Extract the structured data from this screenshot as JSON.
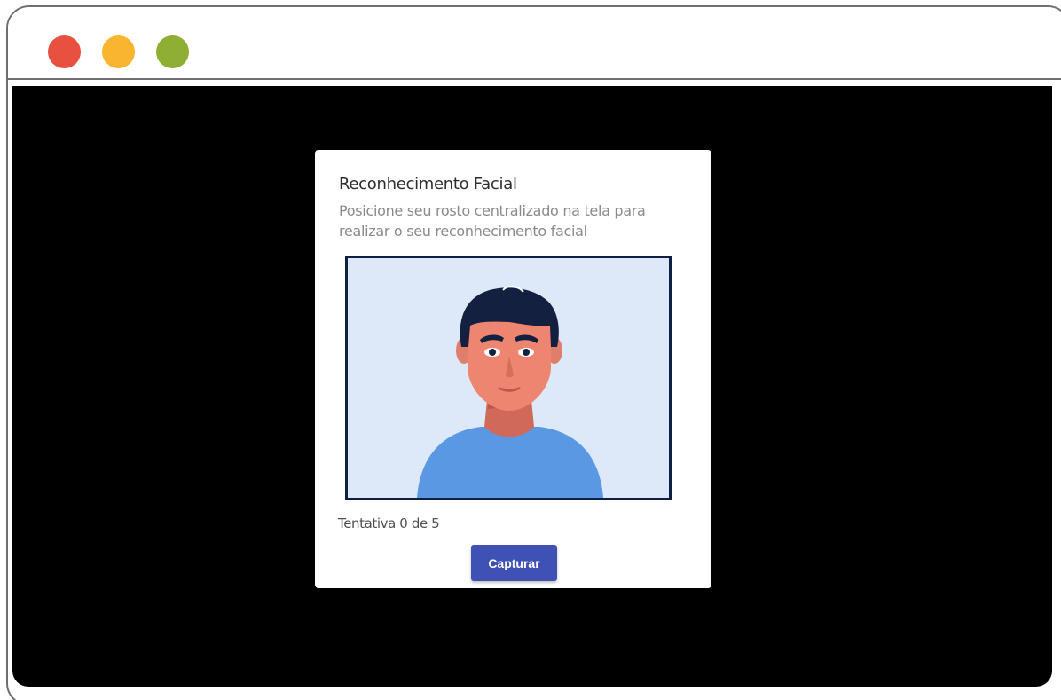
{
  "window": {
    "controls": [
      {
        "name": "close",
        "color": "#e8503f"
      },
      {
        "name": "minimize",
        "color": "#f9b530"
      },
      {
        "name": "maximize",
        "color": "#8fae34"
      }
    ]
  },
  "modal": {
    "title": "Reconhecimento Facial",
    "subtitle": "Posicione seu rosto centralizado na tela para realizar o seu reconhecimento facial",
    "camera_preview": "face-illustration",
    "attempts_text": "Tentativa 0 de 5",
    "attempts_current": 0,
    "attempts_max": 5,
    "capture_label": "Capturar"
  },
  "colors": {
    "button": "#3f51b5",
    "frame_border": "#0f1f44",
    "preview_bg": "#dde8f8",
    "backdrop": "#000000"
  }
}
